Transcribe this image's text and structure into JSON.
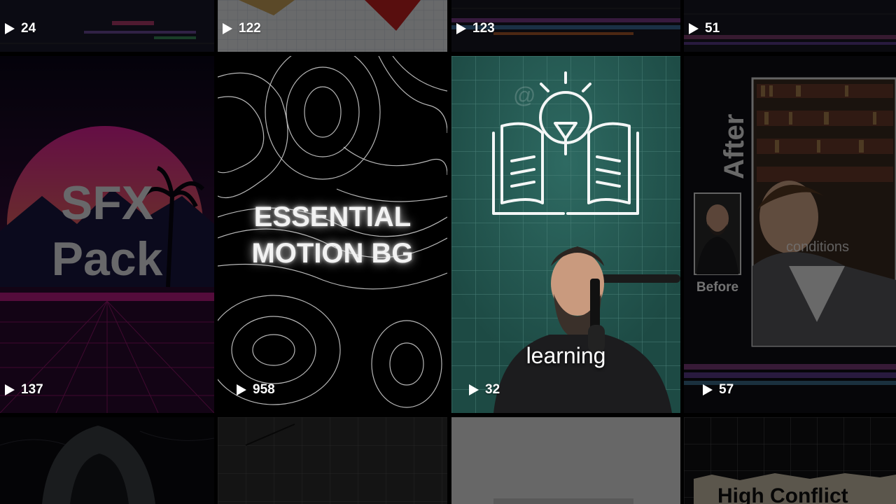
{
  "tiles": [
    {
      "play_count": "24"
    },
    {
      "play_count": "122"
    },
    {
      "play_count": "123"
    },
    {
      "play_count": "51"
    },
    {
      "play_count": "137",
      "title_line1": "SFX",
      "title_line2": "Pack"
    },
    {
      "play_count": "958",
      "title_line1": "ESSENTIAL",
      "title_line2": "MOTION BG"
    },
    {
      "play_count": "32",
      "watermark": "@",
      "caption": "learning"
    },
    {
      "play_count": "57",
      "after_label": "After",
      "before_label": "Before",
      "caption": "conditions"
    },
    {},
    {},
    {},
    {
      "title": "High Conflict"
    }
  ],
  "icons": {
    "play": "play-icon",
    "bulb_book": "lightbulb-book-icon"
  },
  "colors": {
    "accent_teal": "#1d4a44",
    "neon_pink": "#e0209a",
    "sun_orange": "#f0a030"
  }
}
